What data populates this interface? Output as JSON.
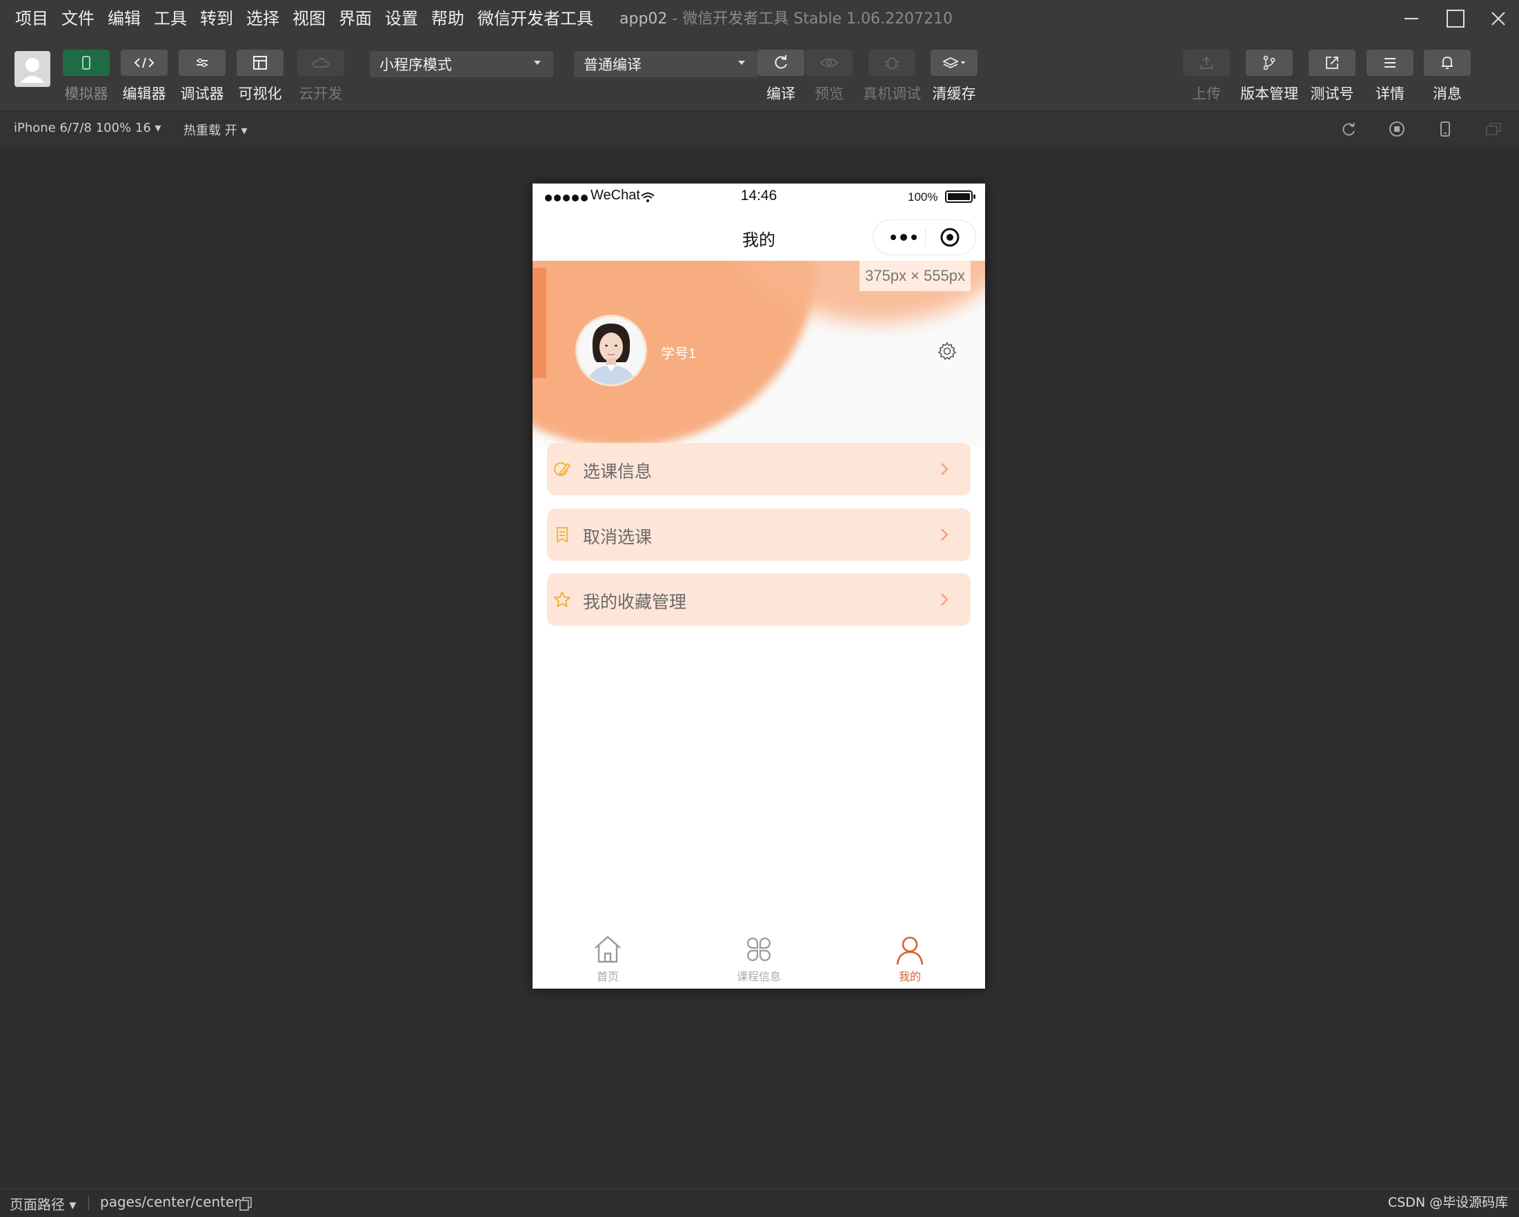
{
  "menubar": {
    "items": [
      "项目",
      "文件",
      "编辑",
      "工具",
      "转到",
      "选择",
      "视图",
      "界面",
      "设置",
      "帮助",
      "微信开发者工具"
    ],
    "title": "app02",
    "title_sub": " - 微信开发者工具 Stable 1.06.2207210"
  },
  "toolbar": {
    "simulator": "模拟器",
    "editor": "编辑器",
    "debugger": "调试器",
    "visual": "可视化",
    "cloud": "云开发",
    "mode_select": "小程序模式",
    "compile_select": "普通编译",
    "compile": "编译",
    "preview": "预览",
    "remote_debug": "真机调试",
    "clear_cache": "清缓存",
    "upload": "上传",
    "version": "版本管理",
    "test_account": "测试号",
    "details": "详情",
    "messages": "消息"
  },
  "devicebar": {
    "device": "iPhone 6/7/8 100% 16 ▾",
    "hot_reload": "热重载 开 ▾"
  },
  "phone": {
    "carrier": "WeChat",
    "time": "14:46",
    "battery": "100%",
    "nav_title": "我的",
    "dimension_label": "375px × 555px",
    "user_name": "学号1",
    "menu": [
      {
        "label": "选课信息",
        "icon": "pencil-icon"
      },
      {
        "label": "取消选课",
        "icon": "document-icon"
      },
      {
        "label": "我的收藏管理",
        "icon": "star-icon"
      }
    ],
    "tabs": [
      {
        "label": "首页",
        "icon": "home-icon"
      },
      {
        "label": "课程信息",
        "icon": "grid-icon"
      },
      {
        "label": "我的",
        "icon": "user-icon"
      }
    ],
    "accent_color": "#d2632f",
    "card_color": "#fde5d8"
  },
  "footer": {
    "path_label": "页面路径 ▾",
    "path": "pages/center/center",
    "watermark": "CSDN @毕设源码库"
  }
}
